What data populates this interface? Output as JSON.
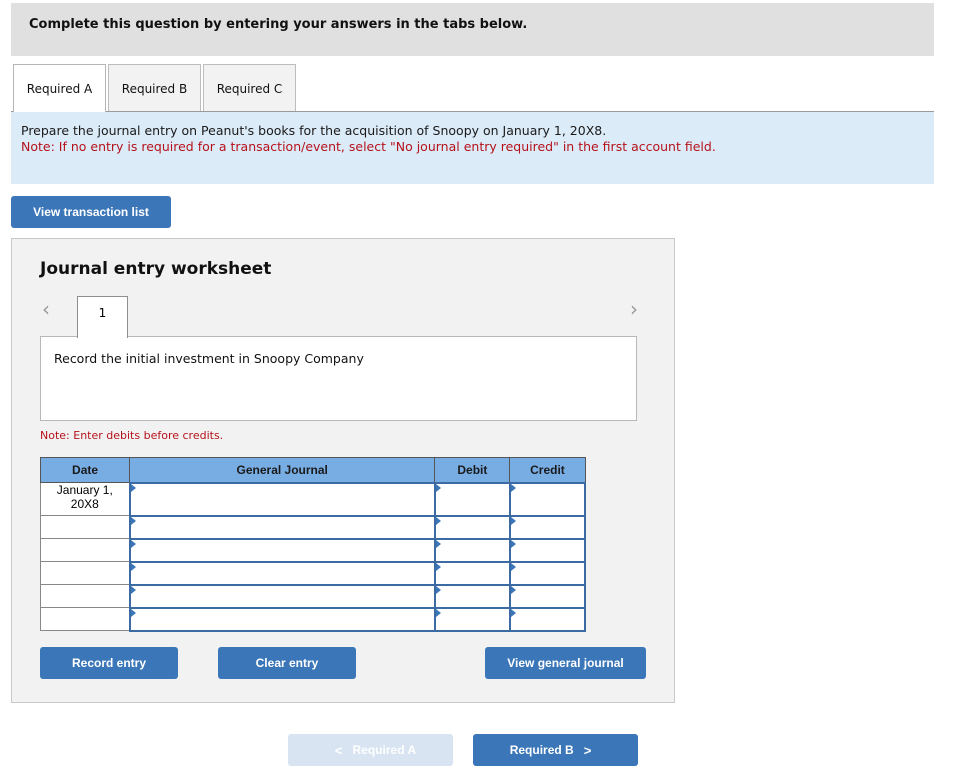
{
  "instructions": {
    "text": "Complete this question by entering your answers in the tabs below."
  },
  "tabs": [
    {
      "label": "Required A",
      "active": true
    },
    {
      "label": "Required B",
      "active": false
    },
    {
      "label": "Required C",
      "active": false
    }
  ],
  "prompt": {
    "text": "Prepare the journal entry on Peanut's books for the acquisition of Snoopy on January 1, 20X8.",
    "note": "Note: If no entry is required for a transaction/event, select \"No journal entry required\" in the first account field."
  },
  "buttons": {
    "view_transaction_list": "View transaction list",
    "record_entry": "Record entry",
    "clear_entry": "Clear entry",
    "view_general_journal": "View general journal",
    "prev_required": "Required A",
    "next_required": "Required B"
  },
  "icons": {
    "prev": "‹",
    "next": "›",
    "chevron_left": "<",
    "chevron_right": ">"
  },
  "worksheet": {
    "title": "Journal entry worksheet",
    "entry_number": "1",
    "description": "Record the initial investment in Snoopy Company",
    "note": "Note: Enter debits before credits.",
    "columns": [
      "Date",
      "General Journal",
      "Debit",
      "Credit"
    ],
    "rows": [
      {
        "date": "January 1, 20X8",
        "account": "",
        "debit": "",
        "credit": ""
      },
      {
        "date": "",
        "account": "",
        "debit": "",
        "credit": ""
      },
      {
        "date": "",
        "account": "",
        "debit": "",
        "credit": ""
      },
      {
        "date": "",
        "account": "",
        "debit": "",
        "credit": ""
      },
      {
        "date": "",
        "account": "",
        "debit": "",
        "credit": ""
      },
      {
        "date": "",
        "account": "",
        "debit": "",
        "credit": ""
      }
    ]
  },
  "colors": {
    "button_blue": "#3b76b8",
    "header_blue": "#78ade4",
    "note_red": "#b5121b",
    "prompt_bg": "#dcebf8",
    "disabled_button": "#d8e4f1"
  }
}
